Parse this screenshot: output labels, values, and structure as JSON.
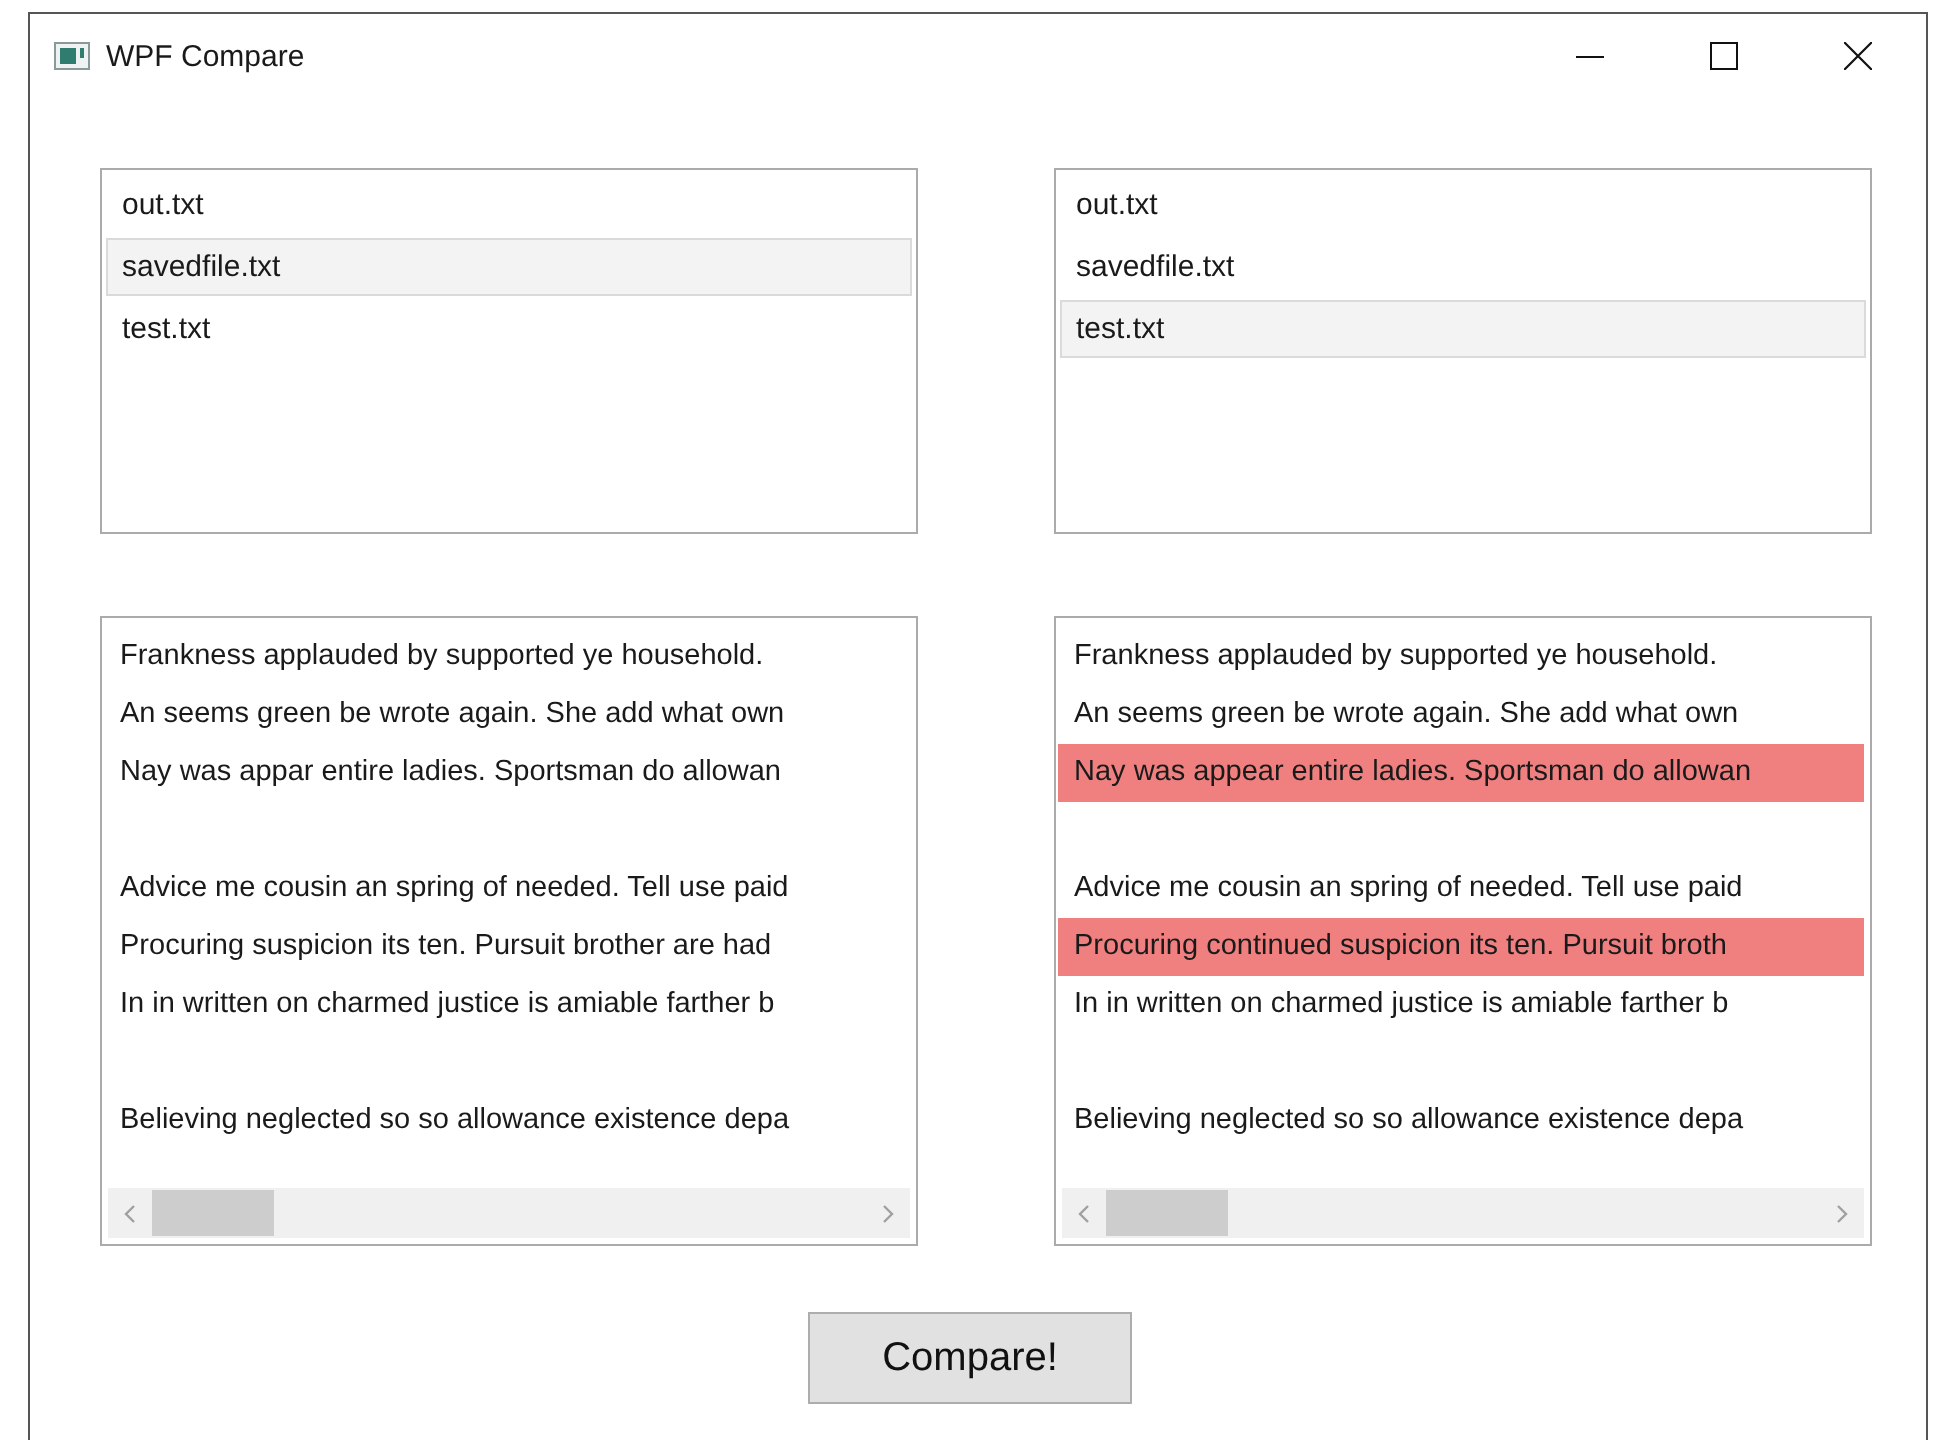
{
  "window": {
    "title": "WPF Compare"
  },
  "file_lists": [
    {
      "items": [
        {
          "name": "out.txt",
          "selected": false
        },
        {
          "name": "savedfile.txt",
          "selected": true
        },
        {
          "name": "test.txt",
          "selected": false
        }
      ]
    },
    {
      "items": [
        {
          "name": "out.txt",
          "selected": false
        },
        {
          "name": "savedfile.txt",
          "selected": false
        },
        {
          "name": "test.txt",
          "selected": true
        }
      ]
    }
  ],
  "text_panes": [
    {
      "lines": [
        {
          "kind": "text",
          "text": "Frankness applauded by supported ye household.",
          "changed": false
        },
        {
          "kind": "text",
          "text": "An seems green be wrote again. She add what own",
          "changed": false
        },
        {
          "kind": "text",
          "text": "Nay was appar entire ladies. Sportsman do allowan",
          "changed": false
        },
        {
          "kind": "blank"
        },
        {
          "kind": "text",
          "text": "Advice me cousin an spring of needed. Tell use paid",
          "changed": false
        },
        {
          "kind": "text",
          "text": "Procuring suspicion its ten. Pursuit brother are had",
          "changed": false
        },
        {
          "kind": "text",
          "text": "In in written on charmed justice is amiable farther b",
          "changed": false
        },
        {
          "kind": "blank"
        },
        {
          "kind": "text",
          "text": "Believing neglected so so allowance existence depa",
          "changed": false
        }
      ]
    },
    {
      "lines": [
        {
          "kind": "text",
          "text": "Frankness applauded by supported ye household.",
          "changed": false
        },
        {
          "kind": "text",
          "text": "An seems green be wrote again. She add what own",
          "changed": false
        },
        {
          "kind": "text",
          "text": "Nay was appear entire ladies. Sportsman do allowan",
          "changed": true
        },
        {
          "kind": "blank"
        },
        {
          "kind": "text",
          "text": "Advice me cousin an spring of needed. Tell use paid",
          "changed": false
        },
        {
          "kind": "text",
          "text": "Procuring continued suspicion its ten. Pursuit broth",
          "changed": true
        },
        {
          "kind": "text",
          "text": "In in written on charmed justice is amiable farther b",
          "changed": false
        },
        {
          "kind": "blank"
        },
        {
          "kind": "text",
          "text": "Believing neglected so so allowance existence depa",
          "changed": false
        }
      ]
    }
  ],
  "compare_button": {
    "label": "Compare!"
  }
}
